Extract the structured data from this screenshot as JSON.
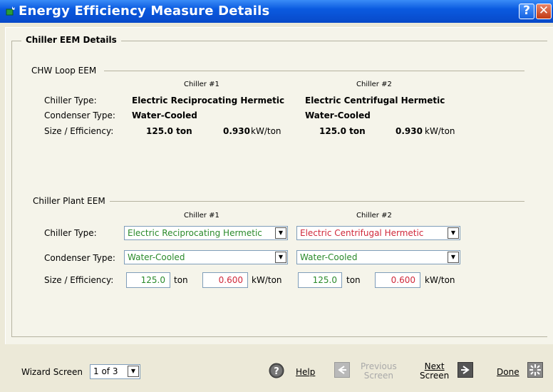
{
  "window": {
    "title": "Energy Efficiency Measure Details",
    "help_btn": "?",
    "close_btn": "✕"
  },
  "group": {
    "title": "Chiller EEM Details"
  },
  "chw_loop": {
    "title": "CHW Loop EEM",
    "chiller1_header": "Chiller #1",
    "chiller2_header": "Chiller #2",
    "row_labels": {
      "chiller_type": "Chiller Type:",
      "condenser_type": "Condenser Type:",
      "size_eff": "Size / Efficiency:"
    },
    "chiller1": {
      "type": "Electric Reciprocating Hermetic",
      "condenser": "Water-Cooled",
      "size": "125.0 ton",
      "eff": "0.930",
      "eff_unit": "kW/ton"
    },
    "chiller2": {
      "type": "Electric Centrifugal Hermetic",
      "condenser": "Water-Cooled",
      "size": "125.0 ton",
      "eff": "0.930",
      "eff_unit": "kW/ton"
    }
  },
  "plant": {
    "title": "Chiller Plant EEM",
    "chiller1_header": "Chiller #1",
    "chiller2_header": "Chiller #2",
    "row_labels": {
      "chiller_type": "Chiller Type:",
      "condenser_type": "Condenser Type:",
      "size_eff": "Size / Efficiency:"
    },
    "chiller1": {
      "type": "Electric Reciprocating Hermetic",
      "condenser": "Water-Cooled",
      "size": "125.0",
      "size_unit": "ton",
      "eff": "0.600",
      "eff_unit": "kW/ton"
    },
    "chiller2": {
      "type": "Electric Centrifugal Hermetic",
      "condenser": "Water-Cooled",
      "size": "125.0",
      "size_unit": "ton",
      "eff": "0.600",
      "eff_unit": "kW/ton"
    }
  },
  "footer": {
    "wizard_label": "Wizard Screen",
    "wizard_value": "1 of 3",
    "help": "Help",
    "previous_line1": "Previous",
    "previous_line2": "Screen",
    "next_line1": "Next",
    "next_line2": "Screen",
    "done": "Done"
  },
  "colors": {
    "title_bar": "#0a5ae0",
    "input_green": "#2a8a2a",
    "input_red": "#d0283a"
  }
}
